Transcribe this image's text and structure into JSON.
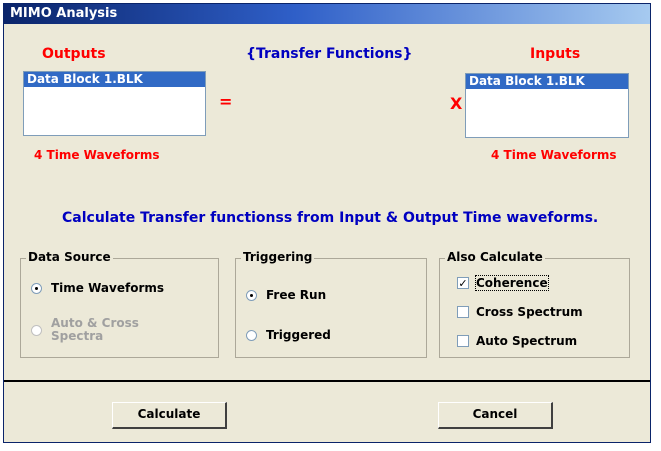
{
  "window": {
    "title": "MIMO Analysis"
  },
  "outputs": {
    "header": "Outputs",
    "items": [
      "Data Block 1.BLK"
    ],
    "count_label": "4 Time Waveforms"
  },
  "transfer_functions_header": "{Transfer Functions}",
  "equals_sign": "=",
  "times_sign": "X",
  "inputs": {
    "header": "Inputs",
    "items": [
      "Data Block 1.BLK"
    ],
    "count_label": "4 Time Waveforms"
  },
  "instruction": "Calculate Transfer functionss from Input & Output Time waveforms.",
  "data_source": {
    "label": "Data Source",
    "options": [
      "Time Waveforms",
      "Auto & Cross",
      "Spectra"
    ],
    "selected": "Time Waveforms"
  },
  "triggering": {
    "label": "Triggering",
    "options": [
      "Free Run",
      "Triggered"
    ],
    "selected": "Free Run"
  },
  "also_calculate": {
    "label": "Also Calculate",
    "options": [
      {
        "label": "Coherence",
        "checked": true
      },
      {
        "label": "Cross Spectrum",
        "checked": false
      },
      {
        "label": "Auto Spectrum",
        "checked": false
      }
    ]
  },
  "buttons": {
    "calculate": "Calculate",
    "cancel": "Cancel"
  },
  "check_mark": "✓"
}
